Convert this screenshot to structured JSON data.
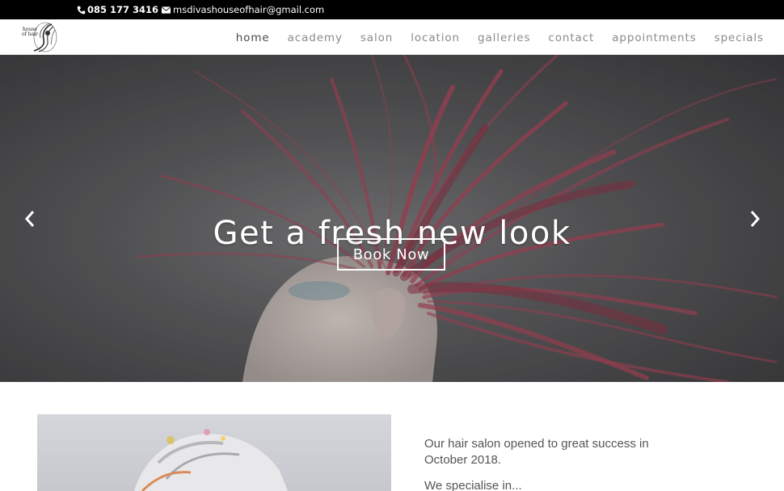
{
  "topbar": {
    "phone": "085 177 3416",
    "email": "msdivashouseofhair@gmail.com",
    "phone_icon": "phone-icon",
    "email_icon": "envelope-icon"
  },
  "logo": {
    "line1": "house",
    "line2": "of hair"
  },
  "nav": {
    "items": [
      {
        "label": "home",
        "active": true
      },
      {
        "label": "academy"
      },
      {
        "label": "salon"
      },
      {
        "label": "location"
      },
      {
        "label": "galleries"
      },
      {
        "label": "contact"
      },
      {
        "label": "appointments"
      },
      {
        "label": "specials"
      }
    ]
  },
  "hero": {
    "title": "Get a fresh new look",
    "button": "Book Now",
    "hair_color": "#a8465a"
  },
  "content": {
    "paragraph1": "Our hair salon opened to great success in October 2018.",
    "paragraph2": "We specialise in..."
  }
}
